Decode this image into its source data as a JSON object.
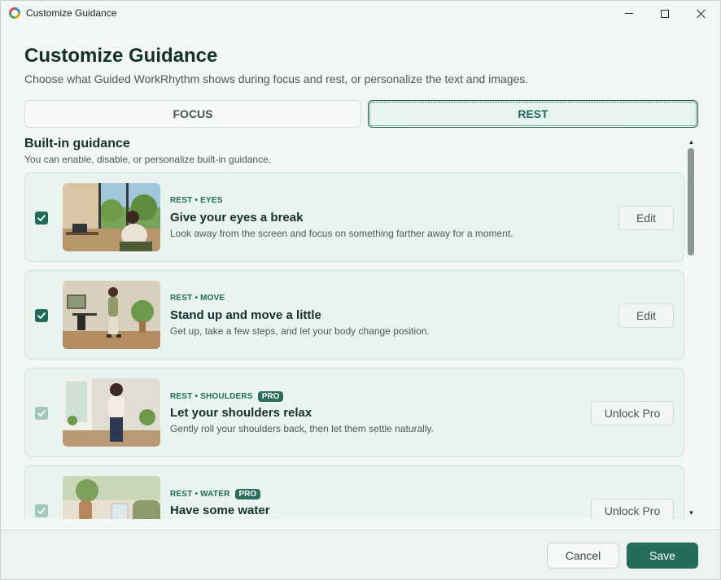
{
  "window": {
    "title": "Customize Guidance"
  },
  "header": {
    "title": "Customize Guidance",
    "subtitle": "Choose what Guided WorkRhythm shows during focus and rest, or personalize the text and images."
  },
  "tabs": [
    {
      "label": "FOCUS",
      "selected": false
    },
    {
      "label": "REST",
      "selected": true
    }
  ],
  "section": {
    "title": "Built-in guidance",
    "description": "You can enable, disable, or personalize built-in guidance."
  },
  "cards": [
    {
      "tag": "REST • EYES",
      "pro": "",
      "title": "Give your eyes a break",
      "description": "Look away from the screen and focus on something farther away for a moment.",
      "action": "Edit",
      "checked": true
    },
    {
      "tag": "REST • MOVE",
      "pro": "",
      "title": "Stand up and move a little",
      "description": "Get up, take a few steps, and let your body change position.",
      "action": "Edit",
      "checked": true
    },
    {
      "tag": "REST • SHOULDERS",
      "pro": "PRO",
      "title": "Let your shoulders relax",
      "description": "Gently roll your shoulders back, then let them settle naturally.",
      "action": "Unlock Pro",
      "checked": true
    },
    {
      "tag": "REST • WATER",
      "pro": "PRO",
      "title": "Have some water",
      "description": "",
      "action": "Unlock Pro",
      "checked": true
    }
  ],
  "footer": {
    "cancel": "Cancel",
    "save": "Save"
  },
  "colors": {
    "accent": "#236d5a",
    "card_bg": "#e9f4f0"
  }
}
